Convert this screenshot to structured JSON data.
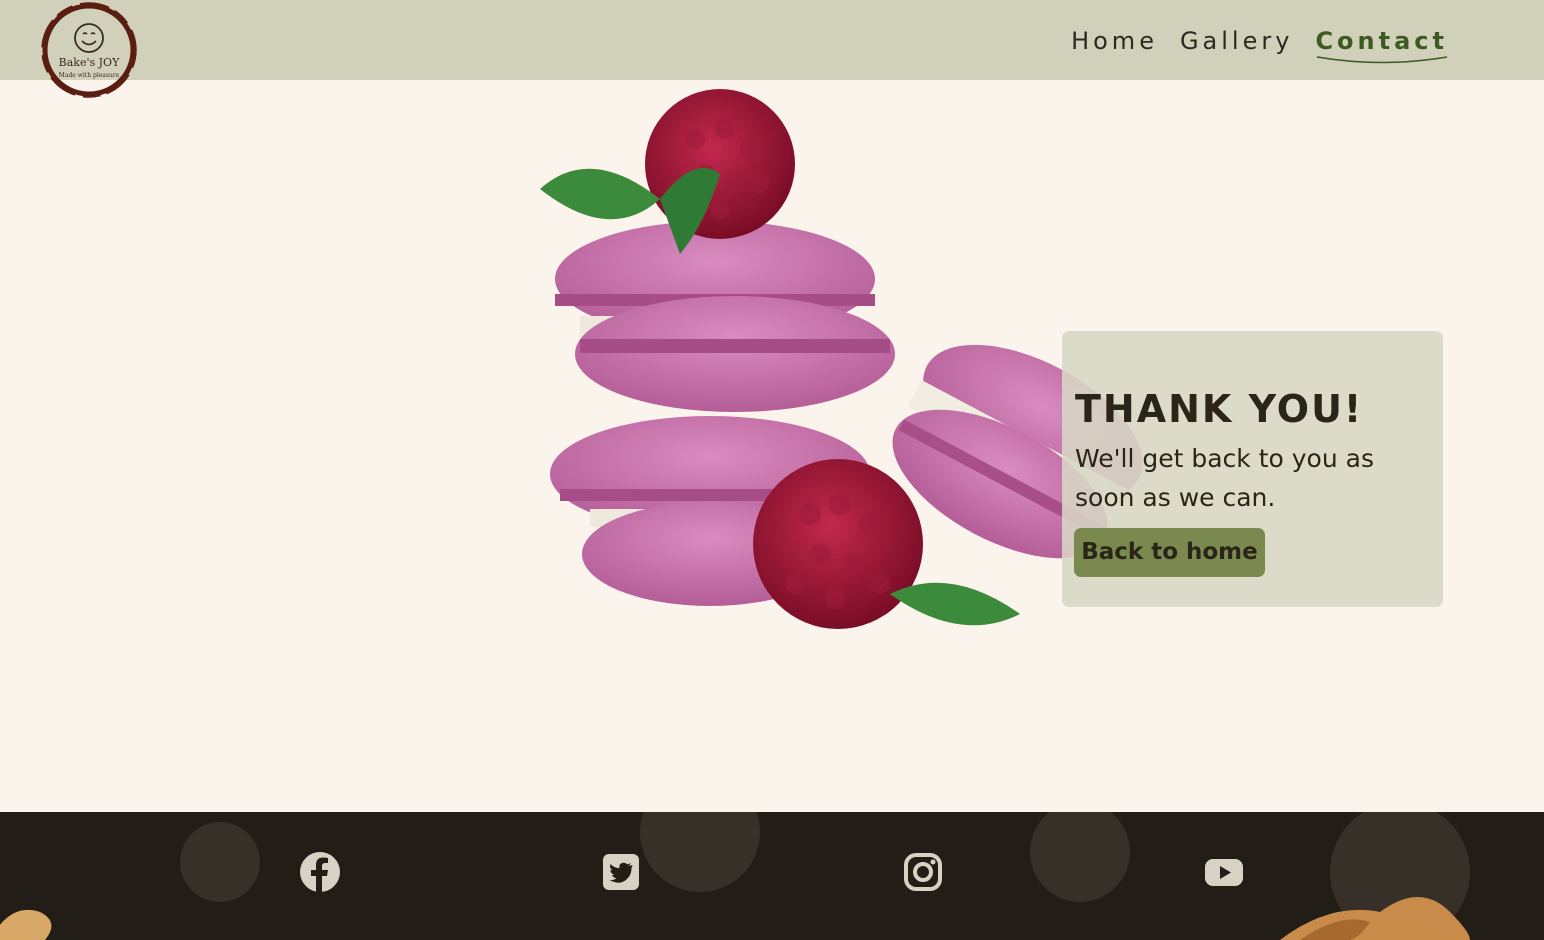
{
  "header": {
    "logo": {
      "name": "Bake's JOY",
      "tagline": "Made with pleasure",
      "icon": "smiley-icon"
    },
    "nav": [
      {
        "label": "Home",
        "active": false
      },
      {
        "label": "Gallery",
        "active": false
      },
      {
        "label": "Contact",
        "active": true
      }
    ]
  },
  "card": {
    "title": "THANK YOU!",
    "message": "We'll get back to you as soon as we can.",
    "button_label": "Back to home"
  },
  "footer": {
    "social": [
      "facebook-icon",
      "twitter-icon",
      "instagram-icon",
      "youtube-icon"
    ]
  },
  "colors": {
    "header_bg": "#d0d0bb",
    "page_bg": "#fbf4ec",
    "accent": "#3d5a20",
    "button_bg": "#7a8a4e",
    "footer_bg": "#221d16"
  }
}
